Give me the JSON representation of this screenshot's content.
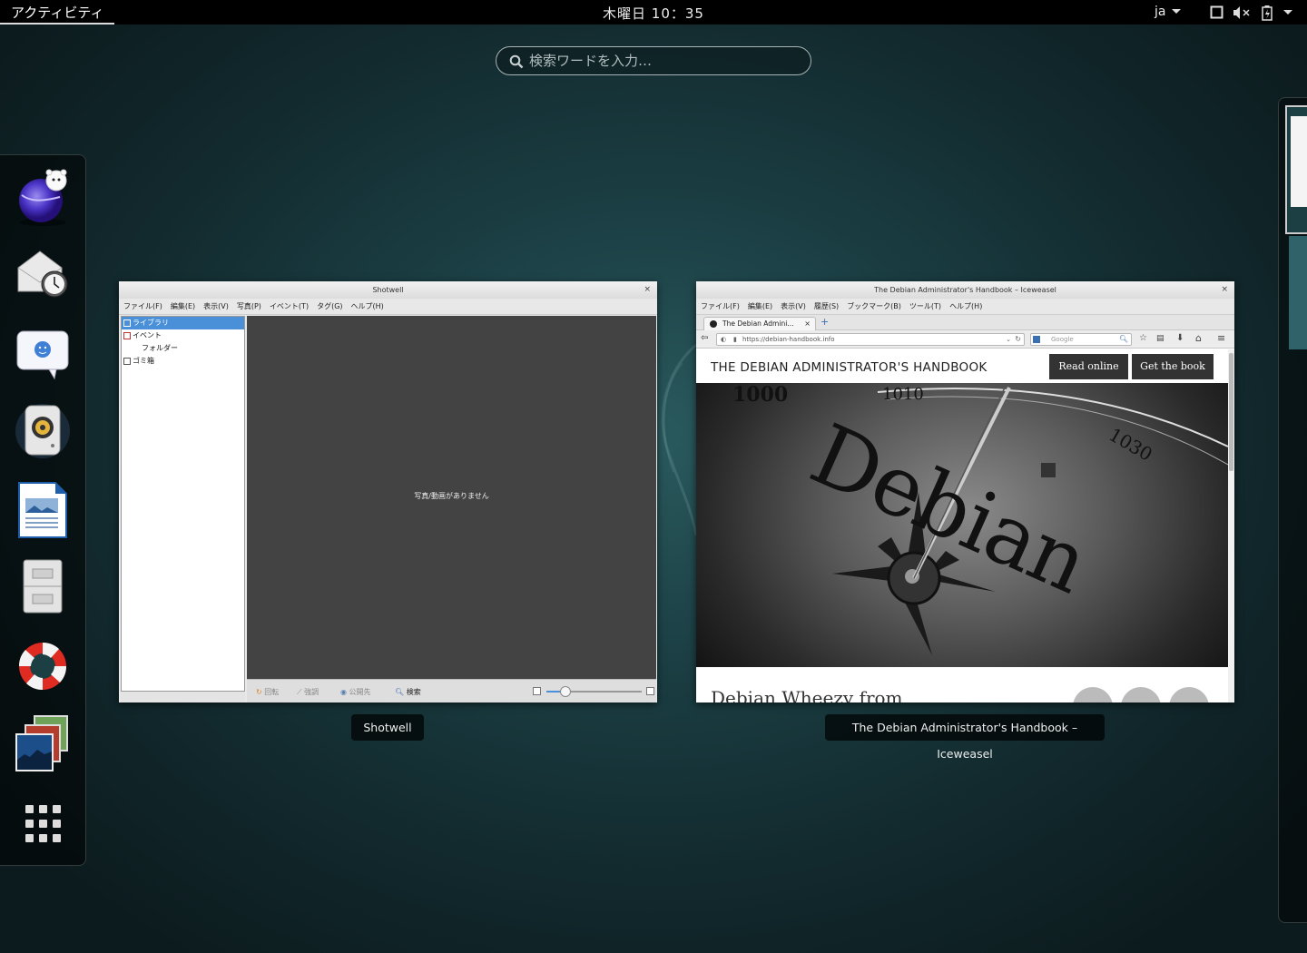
{
  "topbar": {
    "activities_label": "アクティビティ",
    "clock": "木曜日 10：35",
    "language": "ja"
  },
  "search": {
    "placeholder": "検索ワードを入力…"
  },
  "dash": {
    "items": [
      "iceweasel-icon",
      "evolution-mail-icon",
      "empathy-chat-icon",
      "rhythmbox-icon",
      "libreoffice-writer-icon",
      "file-manager-icon",
      "help-icon",
      "shotwell-icon",
      "show-applications-icon"
    ]
  },
  "windows": {
    "shotwell": {
      "title": "Shotwell",
      "caption": "Shotwell",
      "menu": [
        "ファイル(F)",
        "編集(E)",
        "表示(V)",
        "写真(P)",
        "イベント(T)",
        "タグ(G)",
        "ヘルプ(H)"
      ],
      "sidebar": {
        "library": "ライブラリ",
        "events": "イベント",
        "folders": "フォルダー",
        "trash": "ゴミ箱"
      },
      "empty_message": "写真/動画がありません",
      "toolbar": {
        "rotate": "回転",
        "enhance": "強調",
        "publish": "公開先",
        "search": "検索"
      }
    },
    "iceweasel": {
      "title": "The Debian Administrator's Handbook – Iceweasel",
      "caption": "The Debian Administrator's Handbook – Iceweasel",
      "menu": [
        "ファイル(F)",
        "編集(E)",
        "表示(V)",
        "履歴(S)",
        "ブックマーク(B)",
        "ツール(T)",
        "ヘルプ(H)"
      ],
      "tab_title": "The Debian Admini…",
      "url": "https://debian-handbook.info",
      "search_placeholder": "Google",
      "site": {
        "title": "THE DEBIAN ADMINISTRATOR'S HANDBOOK",
        "read_online": "Read online",
        "get_book": "Get the book",
        "hero_word": "Debian",
        "subtitle": "Debian Wheezy from"
      }
    }
  }
}
